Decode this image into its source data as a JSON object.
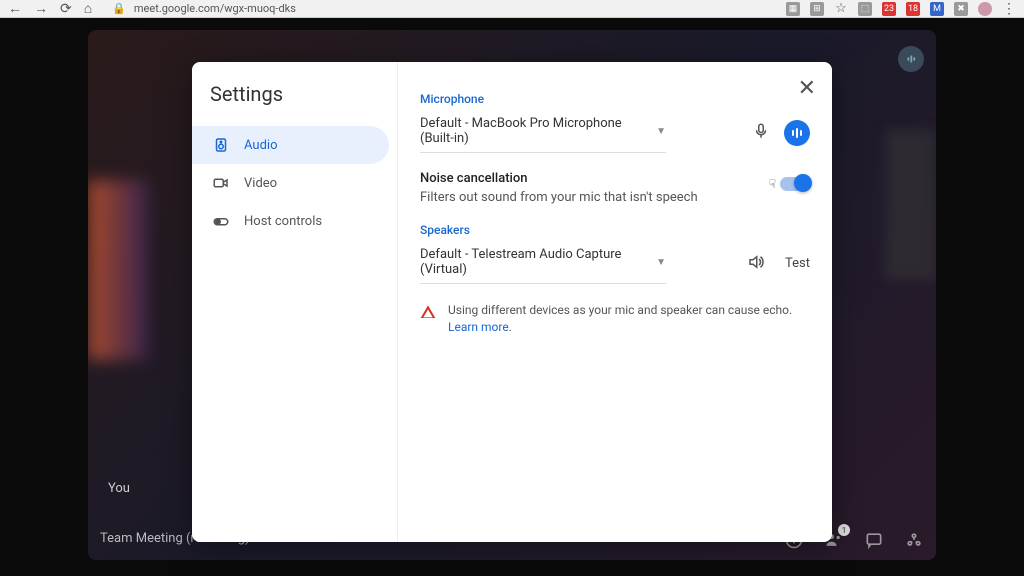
{
  "browser": {
    "url": "meet.google.com/wgx-muoq-dks",
    "ext_badges": [
      "23",
      "18"
    ]
  },
  "meeting": {
    "you_label": "You",
    "title": "Team Meeting (recording)",
    "participants_badge": "1"
  },
  "settings": {
    "title": "Settings",
    "sidebar": {
      "items": [
        {
          "label": "Audio"
        },
        {
          "label": "Video"
        },
        {
          "label": "Host controls"
        }
      ]
    },
    "audio": {
      "microphone": {
        "label": "Microphone",
        "selected": "Default - MacBook Pro Microphone (Built-in)"
      },
      "noise_cancellation": {
        "name": "Noise cancellation",
        "desc": "Filters out sound from your mic that isn't speech",
        "enabled": true
      },
      "speakers": {
        "label": "Speakers",
        "selected": "Default - Telestream Audio Capture (Virtual)",
        "test_label": "Test"
      },
      "warning": {
        "text": "Using different devices as your mic and speaker can cause echo. ",
        "link": "Learn more"
      }
    }
  }
}
